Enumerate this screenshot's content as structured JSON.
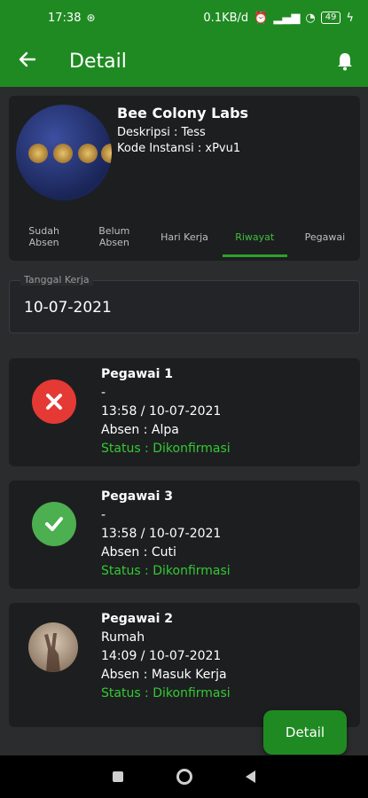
{
  "status_bar": {
    "time": "17:38",
    "data_speed": "0.1KB/d",
    "battery": "49"
  },
  "app_bar": {
    "title": "Detail"
  },
  "profile": {
    "name": "Bee Colony Labs",
    "description": "Deskripsi : Tess",
    "instance_code": "Kode Instansi : xPvu1"
  },
  "tabs": [
    {
      "label": "Sudah Absen"
    },
    {
      "label": "Belum Absen"
    },
    {
      "label": "Hari Kerja"
    },
    {
      "label": "Riwayat"
    },
    {
      "label": "Pegawai"
    }
  ],
  "date_field": {
    "label": "Tanggal Kerja",
    "value": "10-07-2021"
  },
  "records": [
    {
      "name": "Pegawai 1",
      "location": "-",
      "time": "13:58 / 10-07-2021",
      "absence": "Absen : Alpa",
      "status": "Status : Dikonfirmasi",
      "icon": "x-circle-icon"
    },
    {
      "name": "Pegawai 3",
      "location": "-",
      "time": "13:58 / 10-07-2021",
      "absence": "Absen : Cuti",
      "status": "Status : Dikonfirmasi",
      "icon": "check-circle-icon"
    },
    {
      "name": "Pegawai 2",
      "location": "Rumah",
      "time": "14:09 / 10-07-2021",
      "absence": "Absen : Masuk Kerja",
      "status": "Status : Dikonfirmasi",
      "icon": "user-photo"
    }
  ],
  "fab": {
    "label": "Detail"
  },
  "colors": {
    "primary": "#1f8a22",
    "status_text": "#34c934",
    "error": "#e53935",
    "success": "#4caf50"
  }
}
